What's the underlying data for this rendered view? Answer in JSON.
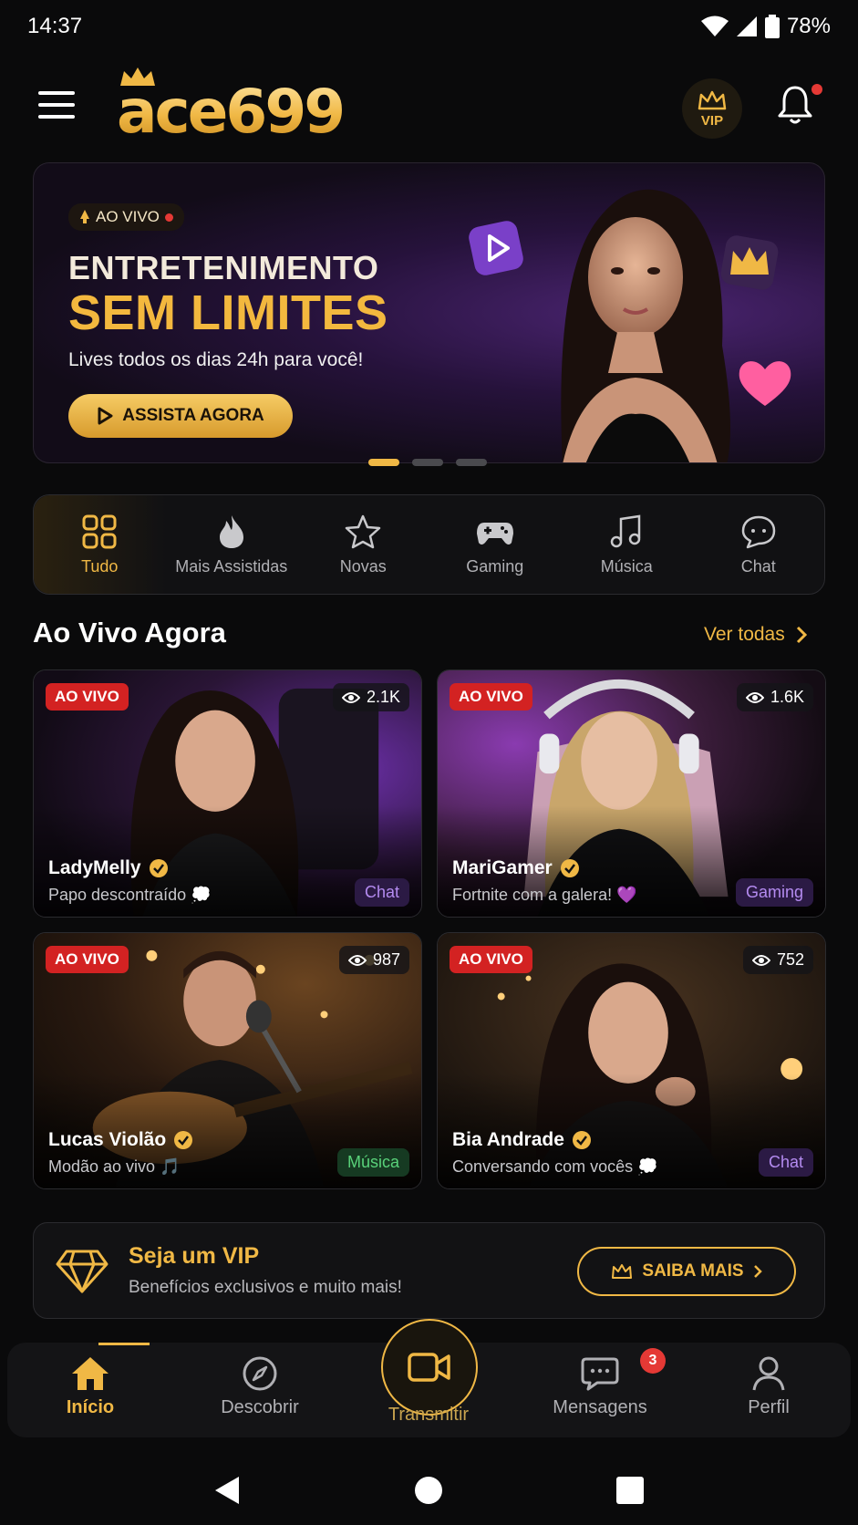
{
  "status_bar": {
    "time": "14:37",
    "battery": "78%"
  },
  "header": {
    "logo": "ace699",
    "vip_label": "VIP"
  },
  "hero": {
    "badge": "AO VIVO",
    "title_line1": "ENTRETENIMENTO",
    "title_line2": "SEM LIMITES",
    "subtitle": "Lives todos os dias 24h para você!",
    "cta": "ASSISTA AGORA",
    "slide_count": 3,
    "active_slide": 1
  },
  "categories": [
    {
      "label": "Tudo",
      "icon": "grid-icon",
      "active": true
    },
    {
      "label": "Mais Assistidas",
      "icon": "flame-icon",
      "active": false
    },
    {
      "label": "Novas",
      "icon": "star-icon",
      "active": false
    },
    {
      "label": "Gaming",
      "icon": "gamepad-icon",
      "active": false
    },
    {
      "label": "Música",
      "icon": "music-icon",
      "active": false
    },
    {
      "label": "Chat",
      "icon": "chat-icon",
      "active": false
    }
  ],
  "live_section": {
    "title": "Ao Vivo Agora",
    "see_all": "Ver todas"
  },
  "streams": [
    {
      "badge": "AO VIVO",
      "viewers": "2.1K",
      "name": "LadyMelly",
      "desc": "Papo descontraído 💭",
      "tag": "Chat"
    },
    {
      "badge": "AO VIVO",
      "viewers": "1.6K",
      "name": "MariGamer",
      "desc": "Fortnite com a galera! 💜",
      "tag": "Gaming"
    },
    {
      "badge": "AO VIVO",
      "viewers": "987",
      "name": "Lucas Violão",
      "desc": "Modão ao vivo 🎵",
      "tag": "Música"
    },
    {
      "badge": "AO VIVO",
      "viewers": "752",
      "name": "Bia Andrade",
      "desc": "Conversando com vocês 💭",
      "tag": "Chat"
    }
  ],
  "vip_banner": {
    "title": "Seja um VIP",
    "subtitle": "Benefícios exclusivos e muito mais!",
    "cta": "SAIBA MAIS"
  },
  "bottom_nav": {
    "items": [
      {
        "label": "Início",
        "icon": "home-icon"
      },
      {
        "label": "Descobrir",
        "icon": "compass-icon"
      },
      {
        "label": "Transmitir",
        "icon": "video-camera-icon"
      },
      {
        "label": "Mensagens",
        "icon": "message-icon"
      },
      {
        "label": "Perfil",
        "icon": "user-icon"
      }
    ],
    "messages_badge": "3"
  },
  "colors": {
    "accent": "#f0b845",
    "live_red": "#d32222",
    "background": "#0a0a0b"
  }
}
